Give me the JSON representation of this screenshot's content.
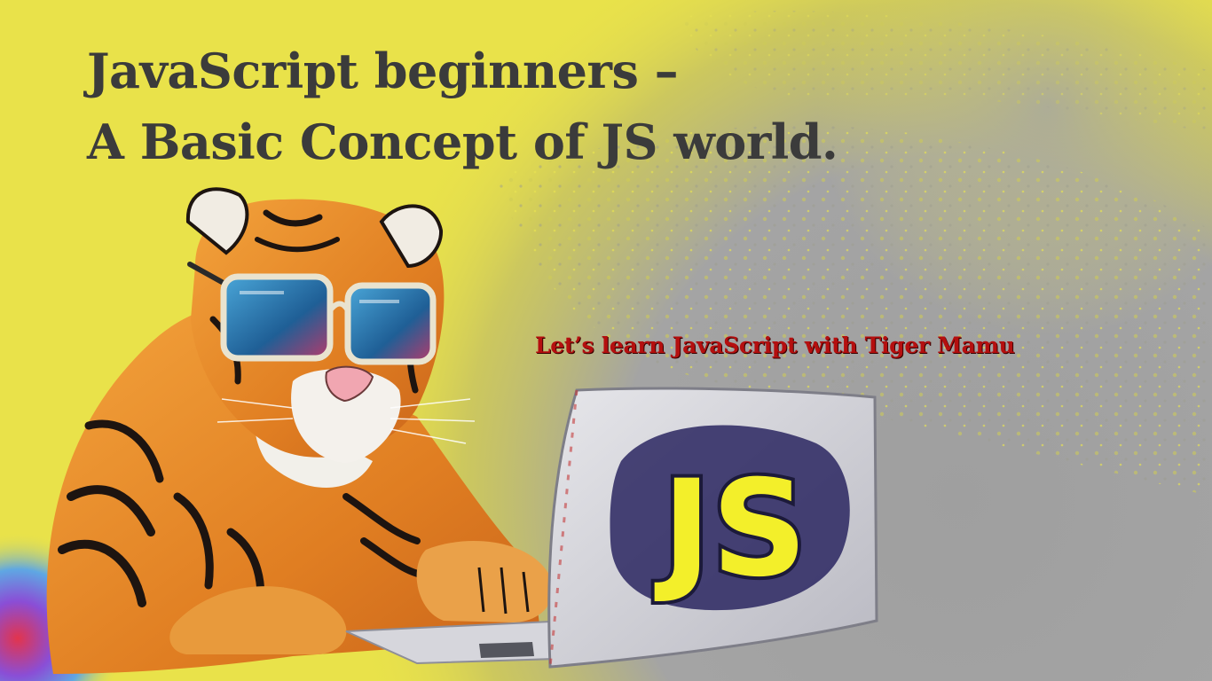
{
  "title": {
    "line1": "JavaScript beginners –",
    "line2": "A Basic Concept of JS world."
  },
  "tagline": "Let’s learn JavaScript with Tiger Mamu",
  "illustration": {
    "laptop_logo_text": "JS",
    "subject": "tiger-with-sunglasses-using-laptop-icon"
  },
  "colors": {
    "background_yellow": "#e9e24a",
    "background_gray": "#a1a1a1",
    "title_text": "#3b3b3b",
    "tagline_text": "#b50f0f",
    "js_logo_yellow": "#f3ef2a"
  }
}
